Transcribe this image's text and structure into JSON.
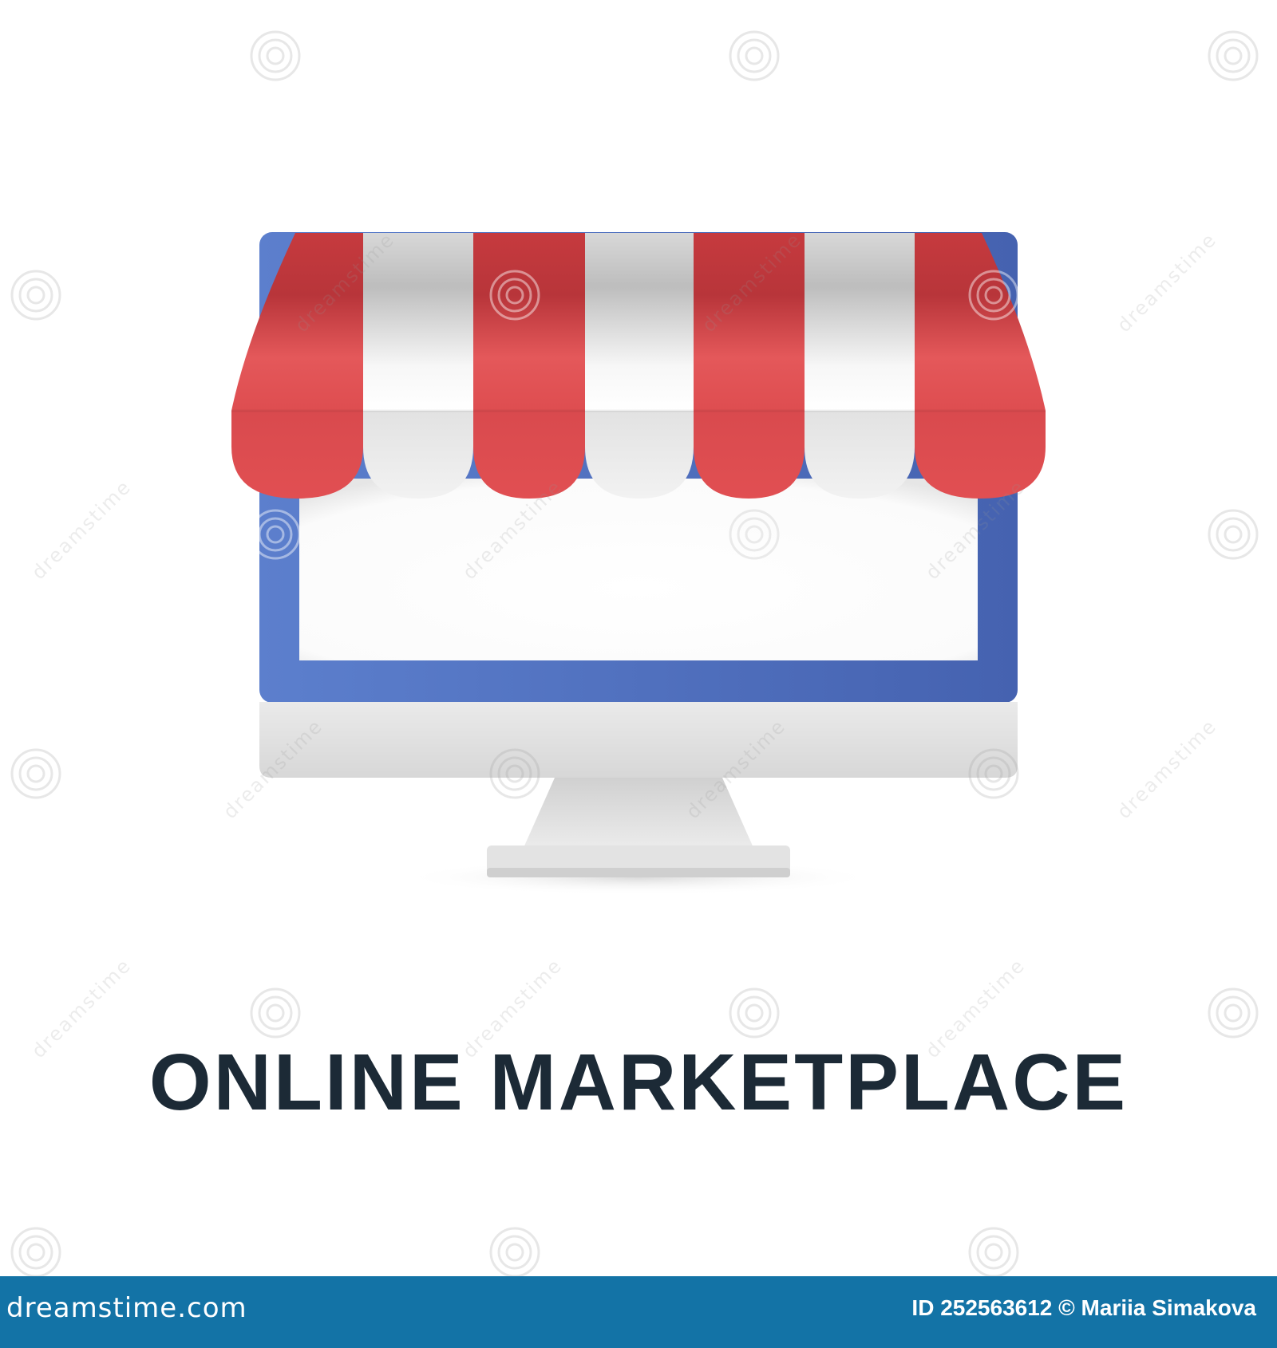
{
  "caption": "ONLINE MARKETPLACE",
  "watermark": {
    "text": "dreamstime",
    "icon": "spiral-logo-icon"
  },
  "footer": {
    "logo_text": "dreamstime.com",
    "credit": "ID 252563612 © Mariia Simakova"
  },
  "illustration": {
    "icon": "computer-monitor-storefront-awning-icon",
    "colors": {
      "awning_red": "#e0494c",
      "awning_white": "#f1f1f1",
      "monitor_blue": "#4f73c4",
      "monitor_body": "#e6e6e6",
      "screen": "#ffffff",
      "caption_text": "#1c2a36",
      "footer_bar": "#1373a6"
    }
  }
}
